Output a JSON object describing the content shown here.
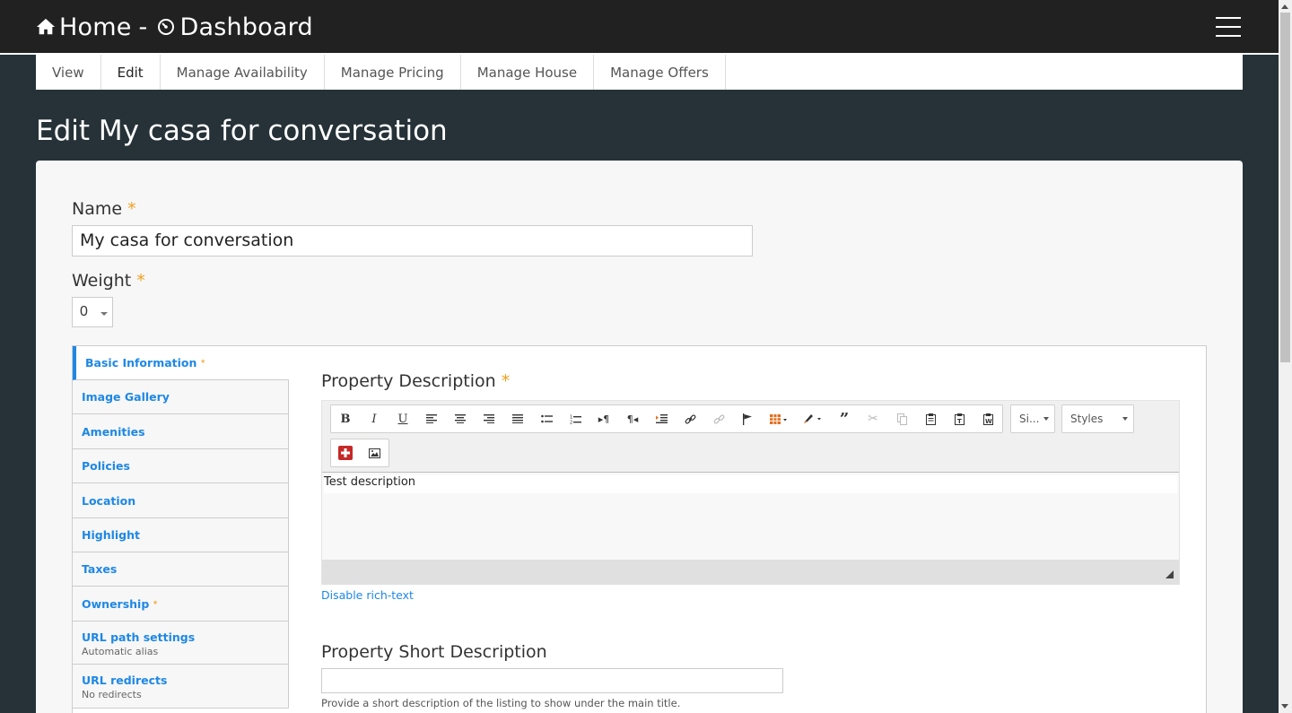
{
  "header": {
    "home_label": "Home",
    "separator": "-",
    "dashboard_label": "Dashboard",
    "icons": {
      "home": "home-icon",
      "dashboard": "dashboard-gauge-icon",
      "menu": "hamburger-menu-icon"
    }
  },
  "tabs": [
    {
      "label": "View"
    },
    {
      "label": "Edit",
      "active": true
    },
    {
      "label": "Manage Availability"
    },
    {
      "label": "Manage Pricing"
    },
    {
      "label": "Manage House"
    },
    {
      "label": "Manage Offers"
    }
  ],
  "page": {
    "title": "Edit My casa for conversation"
  },
  "form": {
    "name_label": "Name",
    "required_mark": "*",
    "name_value": "My casa for conversation",
    "weight_label": "Weight",
    "weight_value": "0"
  },
  "vertical_tabs": [
    {
      "label": "Basic Information",
      "required": true,
      "active": true,
      "summary": ""
    },
    {
      "label": "Image Gallery",
      "summary": ""
    },
    {
      "label": "Amenities",
      "summary": ""
    },
    {
      "label": "Policies",
      "summary": ""
    },
    {
      "label": "Location",
      "summary": ""
    },
    {
      "label": "Highlight",
      "summary": ""
    },
    {
      "label": "Taxes",
      "summary": ""
    },
    {
      "label": "Ownership",
      "required": true,
      "summary": ""
    },
    {
      "label": "URL path settings",
      "summary": "Automatic alias"
    },
    {
      "label": "URL redirects",
      "summary": "No redirects"
    }
  ],
  "description": {
    "label": "Property Description",
    "toolbar_font_size": "Si...",
    "toolbar_styles": "Styles",
    "content": "Test description",
    "disable_link": "Disable rich-text"
  },
  "short_description": {
    "label": "Property Short Description",
    "value": "",
    "help": "Provide a short description of the listing to show under the main title."
  },
  "colors": {
    "header_bg": "#212121",
    "page_bg": "#263238",
    "accent": "#1e88e5",
    "required": "#f0a020"
  }
}
